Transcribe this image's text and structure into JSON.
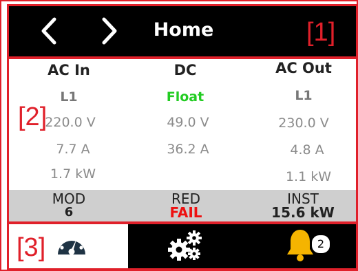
{
  "header": {
    "title": "Home",
    "back_icon": "chevron-left-icon",
    "forward_icon": "chevron-right-icon"
  },
  "annotations": [
    "[1]",
    "[2]",
    "[3]"
  ],
  "columns": [
    {
      "heading": "AC In",
      "sub": "L1",
      "voltage": "220.0 V",
      "current": "7.7 A",
      "power": "1.7 kW"
    },
    {
      "heading": "DC",
      "sub": "Float",
      "voltage": "49.0 V",
      "current": "36.2 A",
      "power": ""
    },
    {
      "heading": "AC Out",
      "sub": "L1",
      "voltage": "230.0 V",
      "current": "4.8 A",
      "power": "1.1 kW"
    }
  ],
  "status": [
    {
      "label": "MOD",
      "value": "6"
    },
    {
      "label": "RED",
      "value": "FAIL"
    },
    {
      "label": "INST",
      "value": "15.6 kW"
    }
  ],
  "tabs": [
    {
      "icon": "gauge-icon",
      "active": true
    },
    {
      "icon": "gears-icon",
      "active": false
    },
    {
      "icon": "bell-icon",
      "badge": "2",
      "active": false
    }
  ],
  "colors": {
    "annotation_red": "#e0202a",
    "float_green": "#22cc22",
    "fail_red": "#ee1111",
    "bell_yellow": "#f5b400",
    "gauge_dark": "#1f3344"
  }
}
